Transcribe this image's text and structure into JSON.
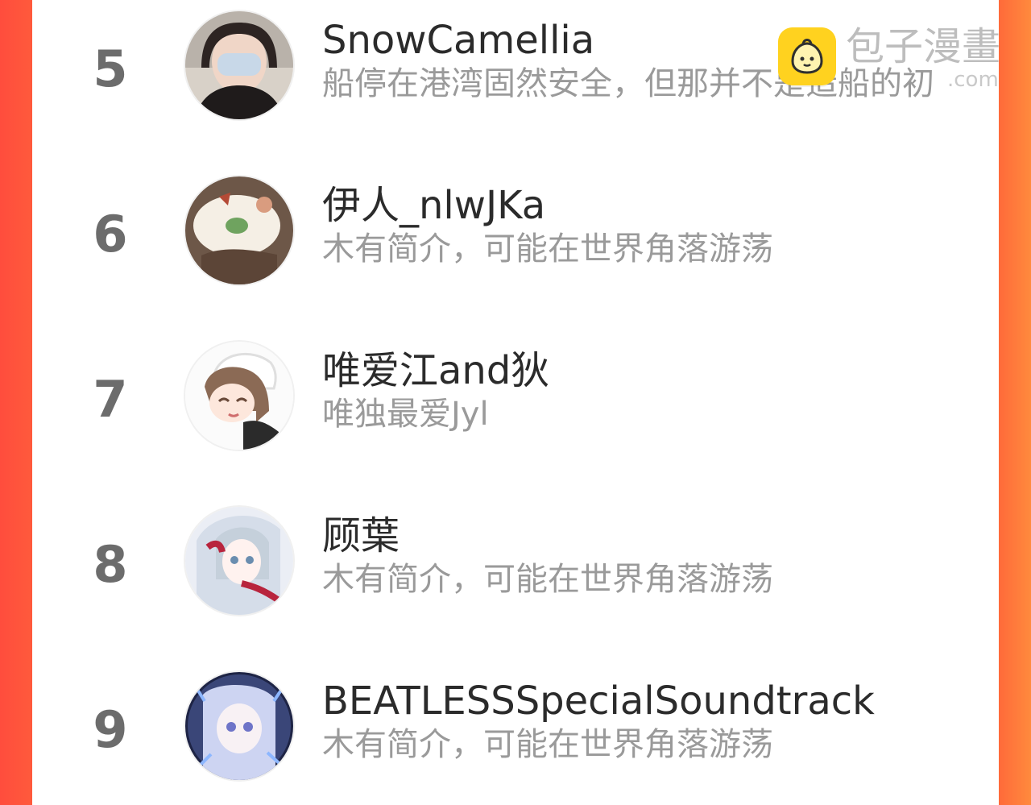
{
  "watermark": {
    "icon": "bun-mascot-icon",
    "text": "包子漫畫",
    "subtext": ".com"
  },
  "ranking": [
    {
      "rank": "5",
      "name": "SnowCamellia",
      "bio": "船停在港湾固然安全，但那并不是造船的初"
    },
    {
      "rank": "6",
      "name": "伊人_nlwJKa",
      "bio": "木有简介，可能在世界角落游荡"
    },
    {
      "rank": "7",
      "name": "唯爱江and狄",
      "bio": "唯独最爱Jyl"
    },
    {
      "rank": "8",
      "name": "顾葉",
      "bio": "木有简介，可能在世界角落游荡"
    },
    {
      "rank": "9",
      "name": "BEATLESSSpecialSoundtrack",
      "bio": "木有简介，可能在世界角落游荡"
    }
  ]
}
